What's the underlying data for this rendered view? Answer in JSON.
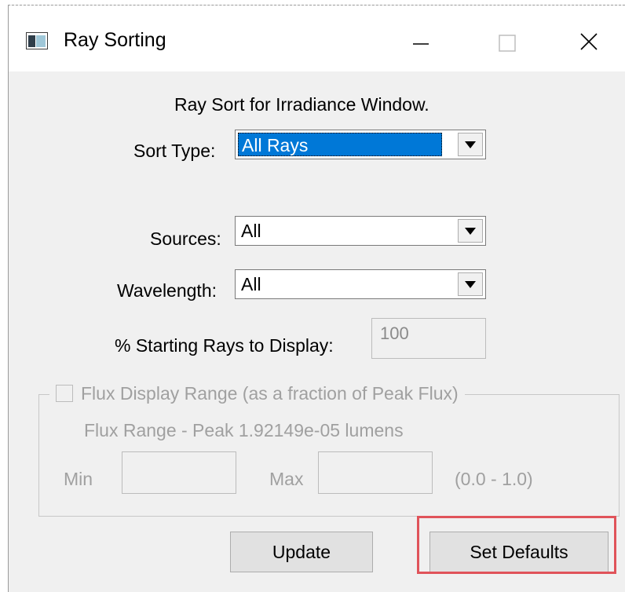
{
  "window": {
    "title": "Ray Sorting"
  },
  "heading": "Ray Sort for Irradiance Window.",
  "sort_type": {
    "label": "Sort Type:",
    "value": "All Rays"
  },
  "sources": {
    "label": "Sources:",
    "value": "All"
  },
  "wavelength": {
    "label": "Wavelength:",
    "value": "All"
  },
  "starting_rays": {
    "label": "% Starting Rays to Display:",
    "value": "100"
  },
  "flux": {
    "checkbox_label": "Flux Display Range (as a fraction of Peak Flux)",
    "range_text": "Flux Range - Peak 1.92149e-05 lumens",
    "min_label": "Min",
    "max_label": "Max",
    "range_hint": "(0.0 - 1.0)",
    "min_value": "",
    "max_value": ""
  },
  "buttons": {
    "update": "Update",
    "set_defaults": "Set Defaults"
  },
  "colors": {
    "selection": "#0078d7",
    "highlight_box": "#e0535a",
    "dialog_bg": "#f0f0f0"
  }
}
